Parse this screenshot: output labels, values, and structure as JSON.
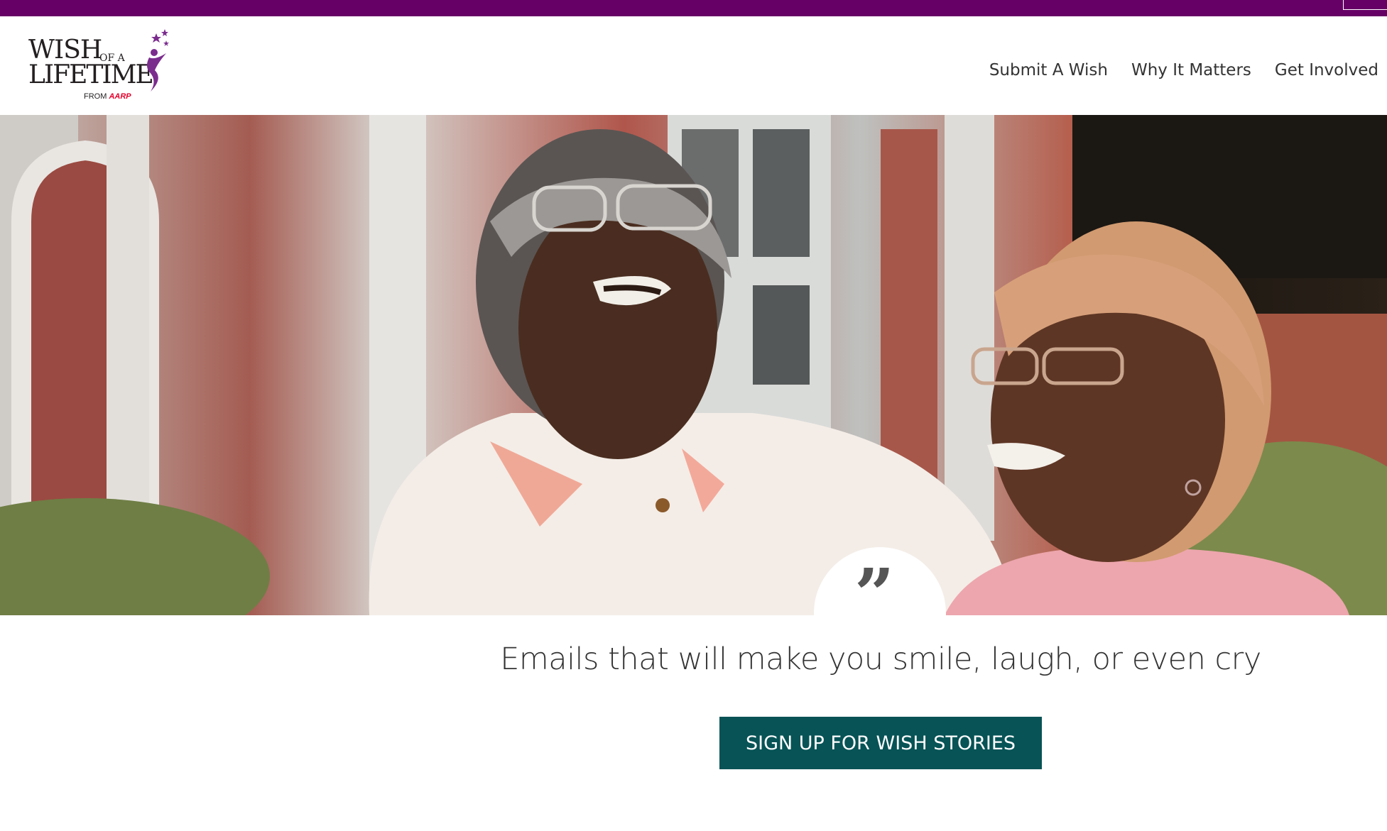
{
  "topbar": {
    "color": "#660066"
  },
  "logo": {
    "line1": "WISH",
    "ofa": "OF A",
    "line2": "LIFETIME",
    "from": "FROM",
    "brand": "AARP"
  },
  "nav": {
    "items": [
      {
        "label": "Submit A Wish"
      },
      {
        "label": "Why It Matters"
      },
      {
        "label": "Get Involved"
      }
    ]
  },
  "hero": {
    "image": "two-older-women-laughing-photo",
    "quote_icon": "quote-icon",
    "quote_glyph": "”"
  },
  "main": {
    "tagline": "Emails that will make you smile, laugh, or even cry",
    "signup_label": "SIGN UP FOR WISH STORIES",
    "signup_color": "#075356"
  }
}
